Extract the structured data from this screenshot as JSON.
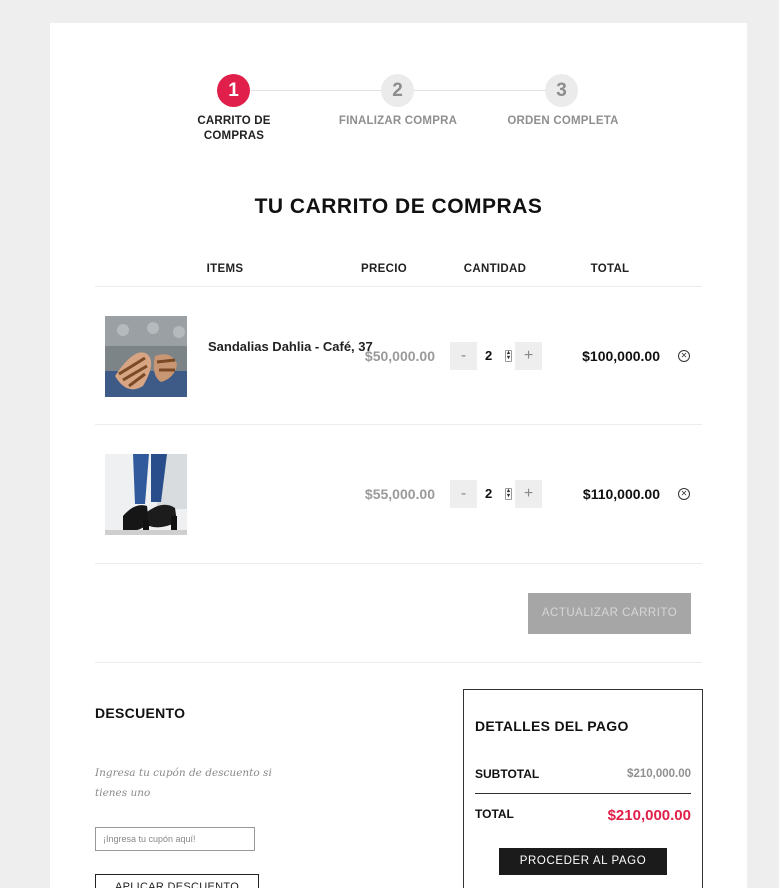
{
  "steps": [
    {
      "number": "1",
      "label": "CARRITO DE COMPRAS",
      "active": true
    },
    {
      "number": "2",
      "label": "FINALIZAR COMPRA",
      "active": false
    },
    {
      "number": "3",
      "label": "ORDEN COMPLETA",
      "active": false
    }
  ],
  "cart": {
    "title": "TU CARRITO DE COMPRAS",
    "headers": {
      "items": "ITEMS",
      "price": "PRECIO",
      "quantity": "CANTIDAD",
      "total": "TOTAL"
    },
    "items": [
      {
        "name": "Sandalias Dahlia - Café, 37",
        "price": "$50,000.00",
        "quantity": "2",
        "total": "$100,000.00",
        "minus": "-",
        "plus": "+"
      },
      {
        "name": "",
        "price": "$55,000.00",
        "quantity": "2",
        "total": "$110,000.00",
        "minus": "-",
        "plus": "+"
      }
    ],
    "update_label": "ACTUALIZAR CARRITO"
  },
  "discount": {
    "title": "DESCUENTO",
    "description": "Ingresa tu cupón de descuento si tienes uno",
    "placeholder": "¡Ingresa tu cupón aquí!",
    "apply_label": "APLICAR DESCUENTO"
  },
  "payment": {
    "title": "DETALLES DEL PAGO",
    "subtotal_label": "SUBTOTAL",
    "subtotal_value": "$210,000.00",
    "total_label": "TOTAL",
    "total_value": "$210,000.00",
    "checkout_label": "PROCEDER AL PAGO"
  },
  "colors": {
    "accent": "#e0204a",
    "dark": "#1b1b1b",
    "muted": "#a6a6a6"
  }
}
